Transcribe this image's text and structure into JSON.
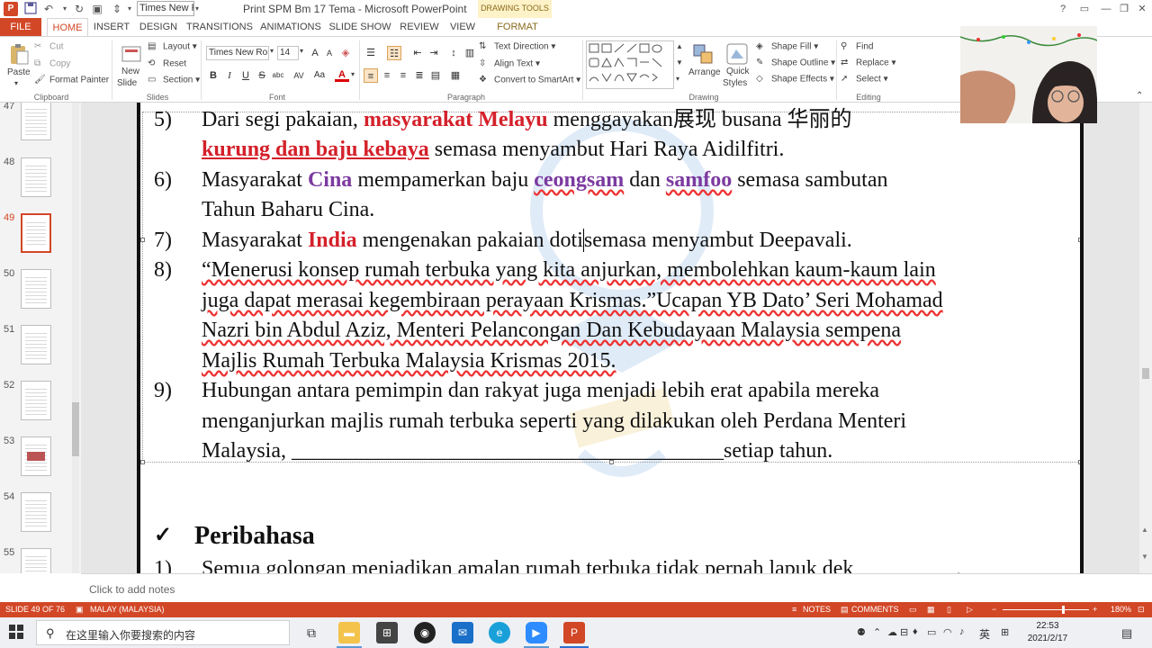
{
  "app": {
    "title": "Print SPM Bm 17 Tema - Microsoft PowerPoint",
    "qat_font": "Times New R",
    "contextual_group": "DRAWING TOOLS"
  },
  "window_controls": [
    "?",
    "▭",
    "—",
    "❐",
    "✕"
  ],
  "tabs": [
    "FILE",
    "HOME",
    "INSERT",
    "DESIGN",
    "TRANSITIONS",
    "ANIMATIONS",
    "SLIDE SHOW",
    "REVIEW",
    "VIEW",
    "FORMAT"
  ],
  "ribbon": {
    "clipboard": {
      "label": "Clipboard",
      "paste": "Paste",
      "cut": "Cut",
      "copy": "Copy",
      "format_painter": "Format Painter"
    },
    "slides": {
      "label": "Slides",
      "new_slide": "New",
      "new_slide2": "Slide",
      "layout": "Layout",
      "reset": "Reset",
      "section": "Section"
    },
    "font": {
      "label": "Font",
      "font_name": "Times New Ror",
      "font_size": "14",
      "bold": "B",
      "italic": "I",
      "underline": "U",
      "strike": "S",
      "shadow": "abc",
      "spacing": "AV",
      "case": "Aa",
      "color": "A",
      "grow": "A",
      "shrink": "A"
    },
    "paragraph": {
      "label": "Paragraph",
      "text_direction": "Text Direction",
      "align_text": "Align Text",
      "smartart": "Convert to SmartArt"
    },
    "drawing": {
      "label": "Drawing",
      "arrange": "Arrange",
      "quick_styles": "Quick",
      "quick_styles2": "Styles",
      "shape_fill": "Shape Fill",
      "shape_outline": "Shape Outline",
      "shape_effects": "Shape Effects"
    },
    "editing": {
      "label": "Editing",
      "find": "Find",
      "replace": "Replace",
      "select": "Select"
    }
  },
  "thumbnails": [
    "47",
    "48",
    "49",
    "50",
    "51",
    "52",
    "53",
    "54",
    "55"
  ],
  "slide": {
    "p5": {
      "num": "5)",
      "l1a": "Dari segi pakaian, ",
      "l1b": "masyarakat Melayu",
      "l1c": " menggayakan展现 busana 华丽的",
      "l2a": "kurung dan baju kebaya",
      "l2b": " semasa menyambut Hari Raya Aidilfitri."
    },
    "p6": {
      "num": "6)",
      "l1a": "Masyarakat ",
      "l1b": "Cina",
      "l1c": " mempamerkan baju ",
      "l1d": "ceongsam",
      "l1e": " dan ",
      "l1f": "samfoo",
      "l1g": " semasa sambutan",
      "l2": "Tahun Baharu Cina."
    },
    "p7": {
      "num": "7)",
      "l1a": "Masyarakat ",
      "l1b": "India",
      "l1c": " mengenakan pakaian doti",
      "l1d": "semasa menyambut Deepavali."
    },
    "p8": {
      "num": "8)",
      "l1": "“Menerusi konsep rumah terbuka yang kita anjurkan, membolehkan kaum-kaum lain",
      "l2": "juga dapat merasai kegembiraan perayaan Krismas.”Ucapan YB Dato’ Seri Mohamad",
      "l3": "Nazri bin Abdul Aziz, Menteri Pelancongan Dan Kebudayaan Malaysia sempena",
      "l4": "Majlis Rumah Terbuka Malaysia Krismas 2015."
    },
    "p9": {
      "num": "9)",
      "l1": "Hubungan antara pemimpin dan rakyat juga menjadi lebih erat apabila mereka",
      "l2": "menganjurkan majlis rumah terbuka seperti yang dilakukan oleh Perdana Menteri",
      "l3": "Malaysia, ________________________________________setiap tahun."
    },
    "section": {
      "check": "✓",
      "title": "Peribahasa"
    },
    "p1": {
      "num": "1)",
      "l1": "Semua golongan menjadikan amalan rumah terbuka tidak pernah lapuk dek _________,"
    }
  },
  "notes_placeholder": "Click to add notes",
  "status": {
    "slide": "SLIDE 49 OF 76",
    "language": "MALAY (MALAYSIA)",
    "notes": "NOTES",
    "comments": "COMMENTS",
    "zoom": "180%"
  },
  "taskbar": {
    "search": "在这里输入你要搜索的内容",
    "ime": "英",
    "time": "22:53",
    "date": "2021/2/17"
  },
  "colors": {
    "accent": "#d24726",
    "red_text": "#d4202a",
    "purple_text": "#7b3aa0"
  }
}
